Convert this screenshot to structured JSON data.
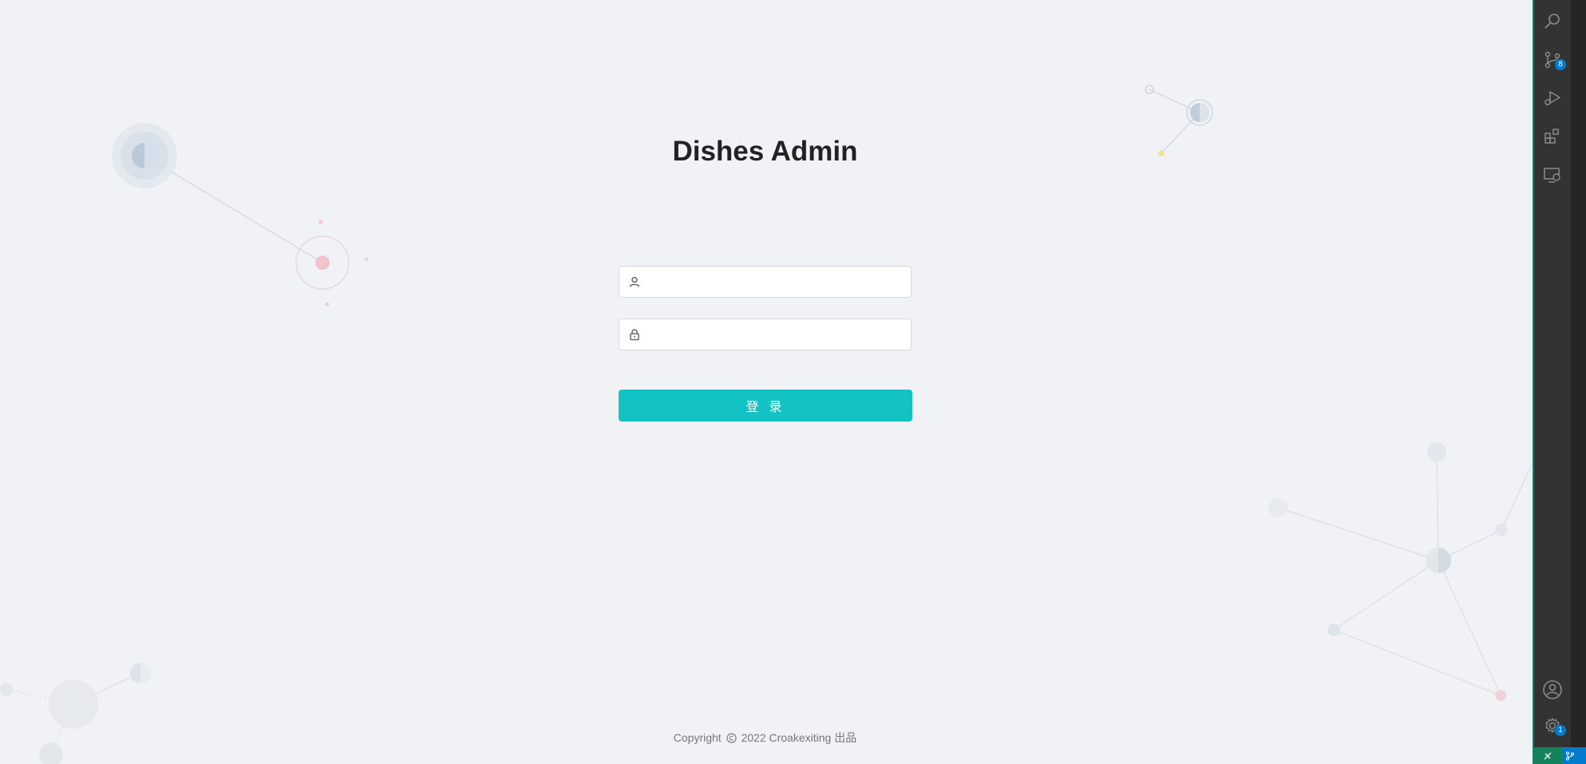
{
  "app": {
    "title": "Dishes Admin"
  },
  "login": {
    "username": {
      "value": "",
      "placeholder": ""
    },
    "password": {
      "value": "",
      "placeholder": ""
    },
    "submit_label": "登 录"
  },
  "footer": {
    "before": "Copyright",
    "after": "2022 Croakexiting 出品"
  },
  "activity_bar": {
    "source_control_badge": "8",
    "settings_badge": "1",
    "icons": [
      "search-icon",
      "source-control-icon",
      "run-debug-icon",
      "extensions-icon",
      "remote-explorer-icon",
      "account-icon",
      "settings-gear-icon"
    ]
  },
  "colors": {
    "background": "#f0f2f5",
    "accent": "#13c2c2",
    "activity_bar": "#333333",
    "status_remote": "#16825d",
    "status_branch": "#007acc"
  }
}
